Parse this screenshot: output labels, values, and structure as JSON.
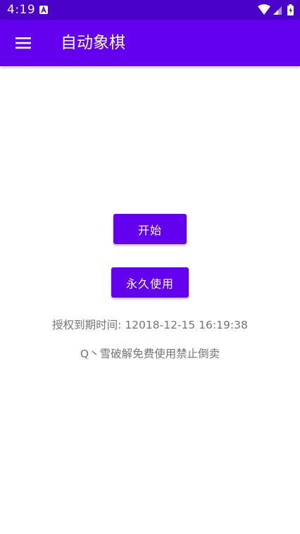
{
  "status_bar": {
    "time": "4:19",
    "notification_icon": "android-auto-icon",
    "icons": [
      "wifi-icon",
      "signal-icon",
      "battery-charging-icon"
    ]
  },
  "app_bar": {
    "menu_icon": "hamburger-menu-icon",
    "title": "自动象棋"
  },
  "main": {
    "start_button_label": "开始",
    "forever_button_label": "永久使用",
    "expiry_text": "授权到期时间: 12018-12-15 16:19:38",
    "note_text": "Q丶雪破解免费使用禁止倒卖"
  },
  "colors": {
    "status_bar": "#4b02c8",
    "primary": "#6300ee",
    "text_secondary": "#757575",
    "background": "#ffffff"
  }
}
